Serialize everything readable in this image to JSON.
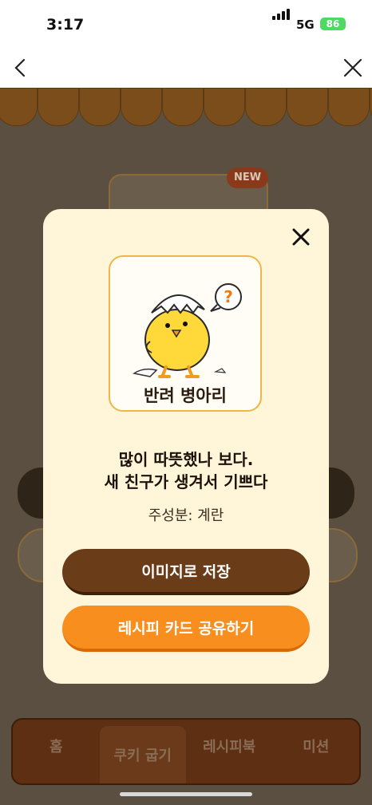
{
  "status_bar": {
    "time": "3:17",
    "network": "5G",
    "battery": "86"
  },
  "nav": {
    "back_icon": "chevron-left-icon",
    "close_icon": "close-icon"
  },
  "background": {
    "new_badge": "NEW",
    "tabs": [
      {
        "label": "홈"
      },
      {
        "label": "쿠키 굽기"
      },
      {
        "label": "레시피북"
      },
      {
        "label": "미션"
      }
    ]
  },
  "modal": {
    "card_title": "반려 병아리",
    "message_line1": "많이 따뜻했나 보다.",
    "message_line2": "새 친구가 생겨서 기쁘다",
    "ingredient": "주성분: 계란",
    "save_button": "이미지로 저장",
    "share_button": "레시피 카드 공유하기"
  },
  "colors": {
    "modal_bg": "#fff5d9",
    "card_border": "#f0b547",
    "save_button": "#6a3c17",
    "share_button": "#f88e1e",
    "battery": "#4cd964"
  }
}
